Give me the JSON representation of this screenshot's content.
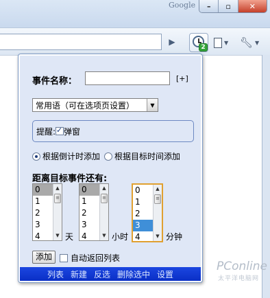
{
  "browser": {
    "search_engine_label": "Google",
    "window_buttons": [
      "–",
      "▫",
      "✕"
    ],
    "go_icon": "play-arrow-icon",
    "extension_badge": "2",
    "extension_icon": "clock-icon",
    "page_menu_icon": "page-icon",
    "tools_menu_icon": "wrench-icon"
  },
  "popup": {
    "event_name_label": "事件名称：",
    "event_name_value": "",
    "event_add_link": "[+]",
    "common_phrases_select": "常用语（可在选项页设置）",
    "reminder_label": "提醒:",
    "popup_checkbox_label": "弹窗",
    "popup_checkbox_checked": true,
    "radio_countdown_label": "根据倒计时添加",
    "radio_target_label": "根据目标时间添加",
    "radio_selected": "countdown",
    "distance_label": "距离目标事件还有:",
    "days_list": [
      "0",
      "1",
      "2",
      "3",
      "4"
    ],
    "days_selected": "0",
    "days_unit": "天",
    "hours_list": [
      "0",
      "1",
      "2",
      "3",
      "4"
    ],
    "hours_selected": "0",
    "hours_unit": "小时",
    "minutes_list": [
      "0",
      "1",
      "2",
      "3",
      "4"
    ],
    "minutes_selected": "3",
    "minutes_unit": "分钟",
    "add_button": "添加",
    "auto_return_label": "自动返回列表",
    "auto_return_checked": false,
    "footer_links": [
      "列表",
      "新建",
      "反选",
      "删除选中",
      "设置"
    ]
  },
  "watermark": {
    "brand": "PConline",
    "sub": "太平洋电脑网"
  },
  "colors": {
    "panel_bg": "#dfe7f6",
    "footer_bg": "#1b46e0",
    "selected_blue": "#3f8fd8",
    "badge_green": "#33a33a"
  }
}
